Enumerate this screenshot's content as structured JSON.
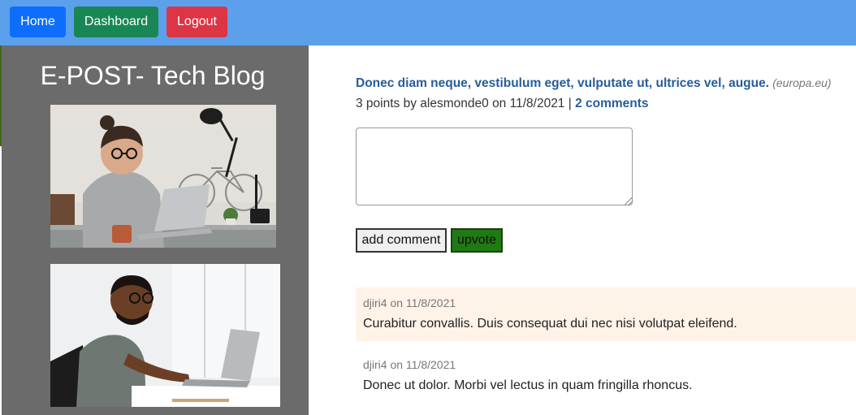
{
  "nav": {
    "home_label": "Home",
    "dashboard_label": "Dashboard",
    "logout_label": "Logout"
  },
  "sidebar": {
    "title": "E-POST- Tech Blog"
  },
  "post": {
    "title": "Donec diam neque, vestibulum eget, vulputate ut, ultrices vel, augue.",
    "domain": "(europa.eu)",
    "points": "3 points",
    "by_label": "by",
    "author": "alesmonde0",
    "on_label": "on",
    "date": "11/8/2021",
    "separator": "|",
    "comments_link": "2 comments"
  },
  "comment_form": {
    "textarea_value": "",
    "add_comment_label": "add comment",
    "upvote_label": "upvote"
  },
  "comments": [
    {
      "meta": "djiri4 on 11/8/2021",
      "text": "Curabitur convallis. Duis consequat dui nec nisi volutpat eleifend."
    },
    {
      "meta": "djiri4 on 11/8/2021",
      "text": "Donec ut dolor. Morbi vel lectus in quam fringilla rhoncus."
    }
  ],
  "colors": {
    "navbar": "#5ca0ec",
    "home": "#0d6efd",
    "dashboard": "#198754",
    "logout": "#dc3545",
    "sidebar": "#6b6b6b",
    "link": "#275d9c",
    "comment_highlight": "#fff3e8",
    "upvote": "#1f7a14"
  }
}
